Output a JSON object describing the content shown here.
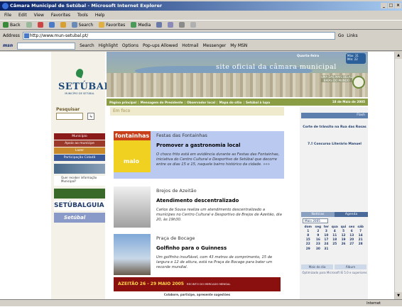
{
  "window": {
    "title": "Câmara Municipal de Setúbal - Microsoft Internet Explorer",
    "controls": [
      "_",
      "□",
      "×"
    ]
  },
  "menu": [
    "File",
    "Edit",
    "View",
    "Favorites",
    "Tools",
    "Help"
  ],
  "toolbar": {
    "back": "Back",
    "forward": "→",
    "search": "Search",
    "favorites": "Favorites",
    "media": "Media"
  },
  "address": {
    "label": "Address",
    "url": "http://www.mun-setubal.pt/",
    "go": "Go",
    "links": "Links"
  },
  "links_bar": {
    "msn": "msn",
    "search": "Search",
    "highlight": "Highlight",
    "options": "Options",
    "popups": "Pop-ups Allowed",
    "hotmail": "Hotmail",
    "messenger": "Messenger",
    "mymsn": "My MSN"
  },
  "site": {
    "logo": "SETÚBAL",
    "logo_sub": "MUNICÍPIO DE SETÚBAL",
    "slogan": "site oficial da câmara municipal",
    "day": "Quarta-feira",
    "temp": {
      "max": "Máx: 31",
      "min": "Mín: 22"
    },
    "assoc": "UMA DAS MAIS BELAS BAÍAS DO MUNDO",
    "nav": [
      "Página principal",
      "Mensagem do Presidente",
      "Observador local",
      "Mapa do sítio",
      "Setúbal à lupa"
    ],
    "date": "18 de Maio de 2005",
    "search_label": "Pesquisar",
    "search_go": "↳",
    "left_menu": [
      {
        "label": "Município",
        "color": "#8b1a1a"
      },
      {
        "label": "Apoio ao munícipe",
        "color": "#9b3a2a"
      },
      {
        "label": "Lazer",
        "color": "#c88a2a"
      },
      {
        "label": "Participação Cidadã",
        "color": "#3a5a9a"
      }
    ],
    "promo_labels": [
      "Quer receber informação Municipal?",
      "SETÚBALGUIA",
      "Setúbal"
    ],
    "en_foco": "Em foco",
    "news": [
      {
        "category": "Festas das Fontainhas",
        "headline": "Promover a gastronomia local",
        "body": "O choco frito está em evidência durante as Festas das Fontainhas, iniciativa do Centro Cultural e Desportivo de Setúbal que decorre entre os dias 15 e 15, naquele bairro histórico da cidade. »»»",
        "thumb_text": "fontainhas",
        "thumb_sub": "maio"
      },
      {
        "category": "Brejos de Azeitão",
        "headline": "Atendimento descentralizado",
        "body": "Carlos de Sousa realiza um atendimento descentralizado a munícipes no Centro Cultural e Desportivo de Brejos de Azeitão, dia 20, às 19h30."
      },
      {
        "category": "Praça de Bocage",
        "headline": "Golfinho para o Guinness",
        "body": "Um golfinho insuflável, com 43 metros de comprimento, 15 de largura e 12 de altura, está na Praça de Bocage para bater um recorde mundial."
      }
    ],
    "festival": "AZEITÃO  26 - 29 MAIO 2005",
    "festival_right": "RECINTO DO MERCADO MENSAL",
    "colab": "Colabore, participe, apresente sugestões",
    "flash_title": "Flash",
    "flash_items": [
      "Corte de trânsito na Rua das Rosas",
      "7.º Concurso Literário Manuel"
    ],
    "tabs": [
      "Notícias",
      "Agenda"
    ],
    "calendar": {
      "month": "Maio 2005",
      "headers": [
        "dom",
        "seg",
        "ter",
        "qua",
        "qui",
        "sex",
        "sáb"
      ],
      "rows": [
        [
          "1",
          "2",
          "3",
          "4",
          "5",
          "6",
          "7"
        ],
        [
          "8",
          "9",
          "10",
          "11",
          "12",
          "13",
          "14"
        ],
        [
          "15",
          "16",
          "17",
          "18",
          "19",
          "20",
          "21"
        ],
        [
          "22",
          "23",
          "24",
          "25",
          "26",
          "27",
          "28"
        ],
        [
          "29",
          "30",
          "31",
          "",
          "",
          "",
          ""
        ]
      ]
    },
    "bottom_tabs": [
      "Mais do dia",
      "Álbum"
    ],
    "optimized": "Optimizado para Microsoft IE 5.0 e superiores"
  },
  "status": {
    "left": "",
    "zone": "Internet"
  }
}
